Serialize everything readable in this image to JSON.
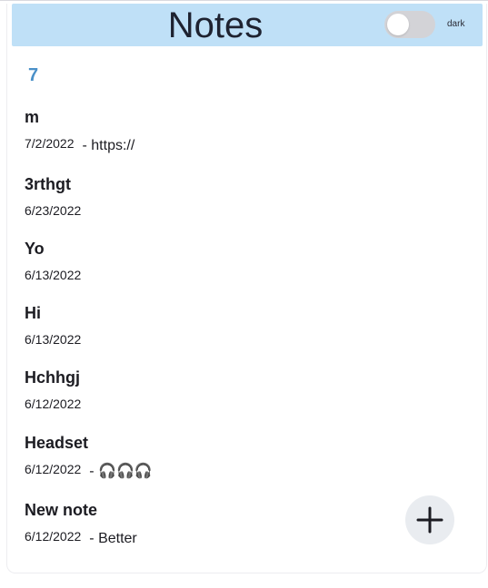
{
  "header": {
    "title": "Notes",
    "dark_label": "dark"
  },
  "notes_count": "7",
  "notes": [
    {
      "title": "m",
      "date": "7/2/2022",
      "preview": "- https://"
    },
    {
      "title": "3rthgt",
      "date": "6/23/2022",
      "preview": ""
    },
    {
      "title": "Yo",
      "date": "6/13/2022",
      "preview": ""
    },
    {
      "title": "Hi",
      "date": "6/13/2022",
      "preview": ""
    },
    {
      "title": "Hchhgj",
      "date": "6/12/2022",
      "preview": ""
    },
    {
      "title": "Headset",
      "date": "6/12/2022",
      "preview": "- 🎧🎧🎧"
    },
    {
      "title": "New note",
      "date": "6/12/2022",
      "preview": "- Better"
    }
  ],
  "colors": {
    "header_bg": "#bfe0f7",
    "count": "#4a90c8",
    "toggle_off": "#d3d3d7",
    "fab_bg": "#e9ecf0"
  },
  "icons": {
    "add": "plus-icon"
  }
}
